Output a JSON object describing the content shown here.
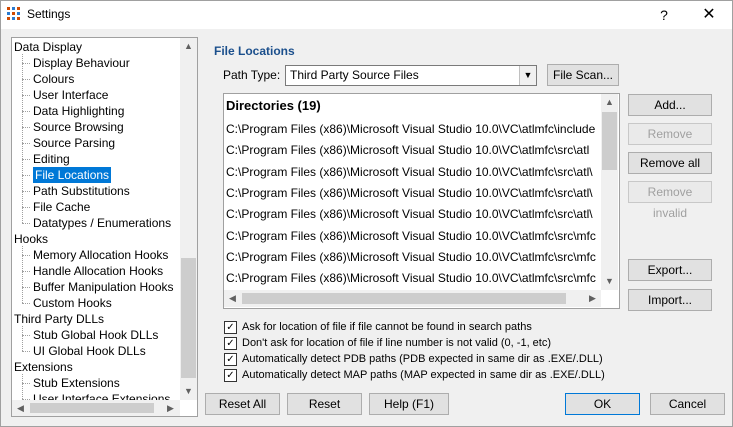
{
  "window": {
    "title": "Settings",
    "help_glyph": "?",
    "close_glyph": "✕"
  },
  "tree": {
    "items": [
      {
        "label": "Data Display",
        "level": 0
      },
      {
        "label": "Display Behaviour",
        "level": 1
      },
      {
        "label": "Colours",
        "level": 1
      },
      {
        "label": "User Interface",
        "level": 1
      },
      {
        "label": "Data Highlighting",
        "level": 1
      },
      {
        "label": "Source Browsing",
        "level": 1
      },
      {
        "label": "Source Parsing",
        "level": 1
      },
      {
        "label": "Editing",
        "level": 1
      },
      {
        "label": "File Locations",
        "level": 1,
        "selected": true
      },
      {
        "label": "Path Substitutions",
        "level": 1
      },
      {
        "label": "File Cache",
        "level": 1
      },
      {
        "label": "Datatypes / Enumerations",
        "level": 1
      },
      {
        "label": "Hooks",
        "level": 0
      },
      {
        "label": "Memory Allocation Hooks",
        "level": 1
      },
      {
        "label": "Handle Allocation Hooks",
        "level": 1
      },
      {
        "label": "Buffer Manipulation Hooks",
        "level": 1
      },
      {
        "label": "Custom Hooks",
        "level": 1
      },
      {
        "label": "Third Party DLLs",
        "level": 0
      },
      {
        "label": "Stub Global Hook DLLs",
        "level": 1
      },
      {
        "label": "UI Global Hook DLLs",
        "level": 1
      },
      {
        "label": "Extensions",
        "level": 0
      },
      {
        "label": "Stub Extensions",
        "level": 1
      },
      {
        "label": "User Interface Extensions",
        "level": 1
      }
    ]
  },
  "file_locations": {
    "title": "File Locations",
    "path_type_label": "Path Type:",
    "path_type_value": "Third Party Source Files",
    "file_scan_button": "File Scan...",
    "directories_header": "Directories (19)",
    "directories": [
      "C:\\Program Files (x86)\\Microsoft Visual Studio 10.0\\VC\\atlmfc\\include",
      "C:\\Program Files (x86)\\Microsoft Visual Studio 10.0\\VC\\atlmfc\\src\\atl",
      "C:\\Program Files (x86)\\Microsoft Visual Studio 10.0\\VC\\atlmfc\\src\\atl\\",
      "C:\\Program Files (x86)\\Microsoft Visual Studio 10.0\\VC\\atlmfc\\src\\atl\\",
      "C:\\Program Files (x86)\\Microsoft Visual Studio 10.0\\VC\\atlmfc\\src\\atl\\",
      "C:\\Program Files (x86)\\Microsoft Visual Studio 10.0\\VC\\atlmfc\\src\\mfc",
      "C:\\Program Files (x86)\\Microsoft Visual Studio 10.0\\VC\\atlmfc\\src\\mfc",
      "C:\\Program Files (x86)\\Microsoft Visual Studio 10.0\\VC\\atlmfc\\src\\mfc"
    ],
    "buttons": {
      "add": "Add...",
      "remove": "Remove",
      "remove_all": "Remove all",
      "remove_invalid": "Remove invalid",
      "export": "Export...",
      "import": "Import..."
    },
    "checkboxes": [
      {
        "label": "Ask for location of file if file cannot be found in search paths",
        "checked": true
      },
      {
        "label": "Don't ask for location of file if line number is not valid (0, -1, etc)",
        "checked": true
      },
      {
        "label": "Automatically detect PDB paths (PDB expected in same dir as .EXE/.DLL)",
        "checked": true
      },
      {
        "label": "Automatically detect MAP paths (MAP expected in same dir as .EXE/.DLL)",
        "checked": true
      }
    ]
  },
  "footer": {
    "reset_all": "Reset All",
    "reset": "Reset",
    "help": "Help (F1)",
    "ok": "OK",
    "cancel": "Cancel"
  },
  "glyphs": {
    "up": "▲",
    "down": "▼",
    "left": "◀",
    "right": "▶",
    "check": "✓"
  }
}
